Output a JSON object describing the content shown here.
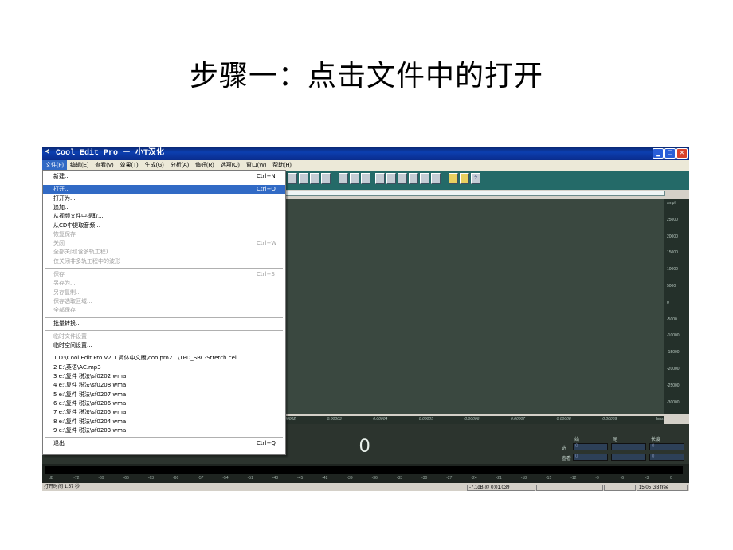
{
  "slide": {
    "title": "步骤一：点击文件中的打开"
  },
  "window": {
    "title": "Cool Edit Pro  － 小T汉化",
    "app_icon": "cooledit-icon",
    "controls": {
      "minimize": "▁",
      "maximize": "□",
      "close": "✕"
    }
  },
  "menubar": [
    {
      "label": "文件(F)",
      "active": true
    },
    {
      "label": "编辑(E)"
    },
    {
      "label": "查看(V)"
    },
    {
      "label": "效果(T)"
    },
    {
      "label": "生成(G)"
    },
    {
      "label": "分析(A)"
    },
    {
      "label": "偏好(R)"
    },
    {
      "label": "选项(O)"
    },
    {
      "label": "窗口(W)"
    },
    {
      "label": "帮助(H)"
    }
  ],
  "file_menu": [
    {
      "label": "新建...",
      "shortcut": "Ctrl+N"
    },
    {
      "sep": true
    },
    {
      "label": "打开...",
      "shortcut": "Ctrl+O",
      "highlight": true
    },
    {
      "label": "打开为..."
    },
    {
      "label": "追加..."
    },
    {
      "label": "从视频文件中提取..."
    },
    {
      "label": "从CD中提取音频..."
    },
    {
      "label": "恢复保存",
      "disabled": true
    },
    {
      "label": "关闭",
      "shortcut": "Ctrl+W",
      "disabled": true
    },
    {
      "label": "全部关闭(含多轨工程)",
      "disabled": true
    },
    {
      "label": "仅关闭非多轨工程中的波形",
      "disabled": true
    },
    {
      "sep": true
    },
    {
      "label": "保存",
      "shortcut": "Ctrl+S",
      "disabled": true
    },
    {
      "label": "另存为...",
      "disabled": true
    },
    {
      "label": "另存复制...",
      "disabled": true
    },
    {
      "label": "保存选取区域...",
      "disabled": true
    },
    {
      "label": "全部保存",
      "disabled": true
    },
    {
      "sep": true
    },
    {
      "label": "批量转换..."
    },
    {
      "sep": true
    },
    {
      "label": "临时文件设置",
      "disabled": true
    },
    {
      "label": "临时空间设置..."
    },
    {
      "sep": true
    },
    {
      "label": "1 D:\\Cool Edit Pro V2.1 简体中文版\\coolpro2...\\TPD_SBC-Stretch.cel"
    },
    {
      "label": "2 E:\\英语\\AC.mp3"
    },
    {
      "label": "3 e:\\复件 税法\\sf0202.wma"
    },
    {
      "label": "4 e:\\复件 税法\\sf0208.wma"
    },
    {
      "label": "5 e:\\复件 税法\\sf0207.wma"
    },
    {
      "label": "6 e:\\复件 税法\\sf0206.wma"
    },
    {
      "label": "7 e:\\复件 税法\\sf0205.wma"
    },
    {
      "label": "8 e:\\复件 税法\\sf0204.wma"
    },
    {
      "label": "9 e:\\复件 税法\\sf0203.wma"
    },
    {
      "sep": true
    },
    {
      "label": "退出",
      "shortcut": "Ctrl+Q"
    }
  ],
  "amplitude_scale": [
    "smpl",
    "25000",
    "20000",
    "15000",
    "10000",
    "5000",
    "0",
    "-5000",
    "-10000",
    "-15000",
    "-20000",
    "-25000",
    "-30000"
  ],
  "timeline": [
    "0.00002",
    "0.00003",
    "0.00004",
    "0.00005",
    "0.00006",
    "0.00007",
    "0.00008",
    "0.00009"
  ],
  "timeline_unit": "hms",
  "time_display": "0",
  "selection_panel": {
    "headers": [
      "始",
      "尾",
      "长度"
    ],
    "rows": [
      {
        "label": "选",
        "values": [
          "0",
          "",
          "0"
        ]
      },
      {
        "label": "查看",
        "values": [
          "0",
          "",
          "0"
        ]
      }
    ]
  },
  "level_scale": [
    "dB",
    "-72",
    "-69",
    "-66",
    "-63",
    "-60",
    "-57",
    "-54",
    "-51",
    "-48",
    "-45",
    "-42",
    "-39",
    "-36",
    "-33",
    "-30",
    "-27",
    "-24",
    "-21",
    "-18",
    "-15",
    "-12",
    "-9",
    "-6",
    "-3",
    "0"
  ],
  "status_bar": {
    "open_time": "打开时间 1.57 秒",
    "level": "-7.1dB @ 0:01.039",
    "disk_free": "15.05 GB free"
  },
  "colors": {
    "titlebar": "#0a246a",
    "highlight": "#316ac5",
    "toolbar": "#246a68",
    "wave_bg": "#3a4840",
    "time_display_fg": "#e8f0ea"
  }
}
